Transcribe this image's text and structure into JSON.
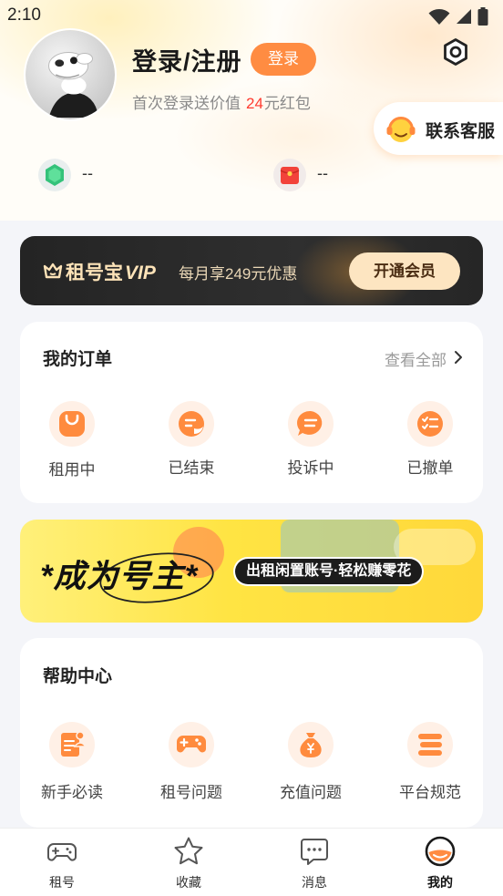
{
  "status_bar": {
    "time": "2:10",
    "icons": [
      "wifi-icon",
      "signal-icon",
      "battery-icon"
    ]
  },
  "profile": {
    "title": "登录/注册",
    "login_button": "登录",
    "promo_prefix": "首次登录送价值",
    "promo_amount": "24",
    "promo_suffix": "元红包",
    "settings_icon": "settings-hexagon-icon"
  },
  "support": {
    "label": "联系客服",
    "icon": "headset-icon"
  },
  "stats": [
    {
      "icon": "green-gem-icon",
      "value": "--"
    },
    {
      "icon": "red-envelope-icon",
      "value": "--"
    }
  ],
  "vip": {
    "brand_name": "租号宝",
    "brand_tag": "VIP",
    "benefit": "每月享249元优惠",
    "button": "开通会员"
  },
  "orders": {
    "title": "我的订单",
    "view_all": "查看全部",
    "items": [
      {
        "label": "租用中",
        "icon": "bag-icon"
      },
      {
        "label": "已结束",
        "icon": "finished-doc-icon"
      },
      {
        "label": "投诉中",
        "icon": "complaint-bubble-icon"
      },
      {
        "label": "已撤单",
        "icon": "cancelled-list-icon"
      }
    ]
  },
  "promo_banner": {
    "headline": "*成为号主*",
    "tagline": "出租闲置账号·轻松赚零花"
  },
  "help": {
    "title": "帮助中心",
    "items": [
      {
        "label": "新手必读",
        "icon": "guide-doc-icon"
      },
      {
        "label": "租号问题",
        "icon": "gamepad-icon"
      },
      {
        "label": "充值问题",
        "icon": "money-bag-icon"
      },
      {
        "label": "平台规范",
        "icon": "layers-icon"
      }
    ]
  },
  "bottom_nav": {
    "items": [
      {
        "label": "租号",
        "icon": "gamepad-outline-icon",
        "active": false
      },
      {
        "label": "收藏",
        "icon": "star-icon",
        "active": false
      },
      {
        "label": "消息",
        "icon": "chat-icon",
        "active": false
      },
      {
        "label": "我的",
        "icon": "profile-face-icon",
        "active": true
      }
    ]
  },
  "colors": {
    "accent": "#ff8c42",
    "promo_red": "#ff3b30",
    "vip_dark": "#2a2a2a",
    "vip_gold": "#fde3b8",
    "banner_yellow": "#ffe443",
    "page_bg": "#f4f5f9"
  }
}
